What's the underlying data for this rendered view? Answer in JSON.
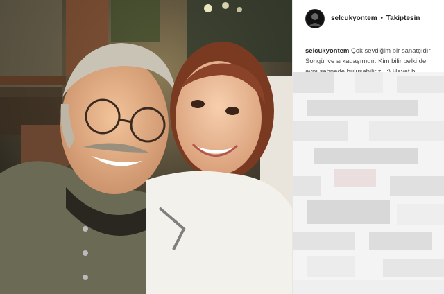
{
  "post": {
    "username": "selcukyontem",
    "separator": "•",
    "follow_status": "Takiptesin",
    "caption_username": "selcukyontem",
    "caption_text": "Çok sevdiğim bir sanatçıdır Songül ve arkadaşımdır. Kim bilir belki de aynı sahnede buluşabiliriz.. :) Hayat bu"
  },
  "icons": {
    "avatar": "profile-avatar",
    "comments_area": "pixelated-censor-block"
  },
  "colors": {
    "text_primary": "#262626",
    "panel_bg": "#ffffff",
    "photo_bg": "#2c2a22"
  }
}
